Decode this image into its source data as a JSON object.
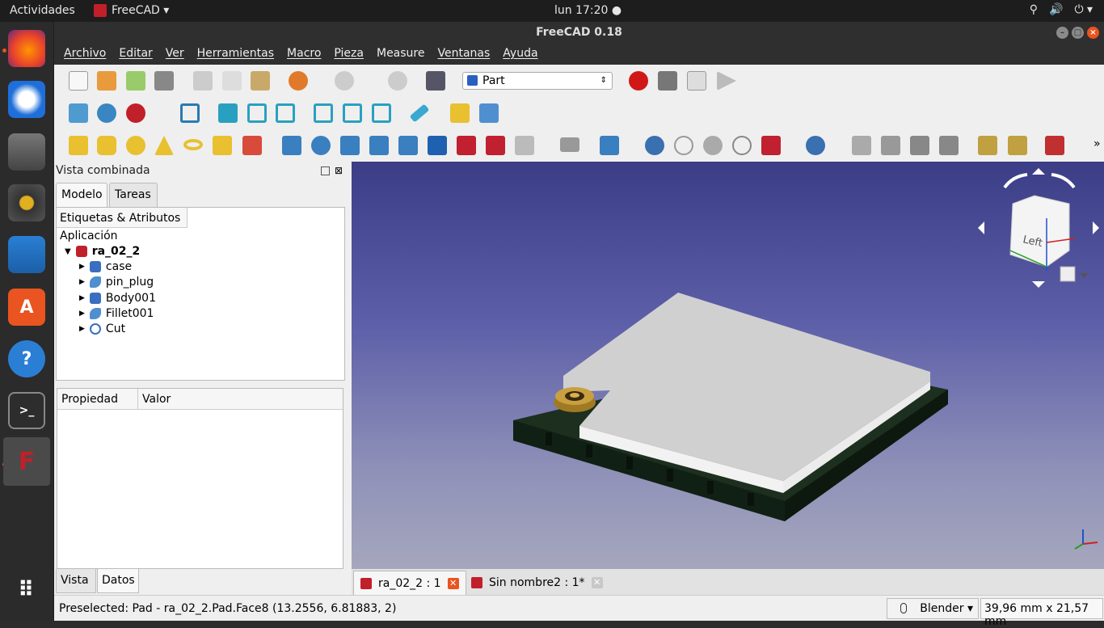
{
  "topbar": {
    "activities": "Actividades",
    "app_name": "FreeCAD ▾",
    "clock": "lun 17:20 ●",
    "sys_icons": [
      "network-icon",
      "volume-icon",
      "power-icon"
    ]
  },
  "window": {
    "title": "FreeCAD 0.18"
  },
  "menu": [
    "Archivo",
    "Editar",
    "Ver",
    "Herramientas",
    "Macro",
    "Pieza",
    "Measure",
    "Ventanas",
    "Ayuda"
  ],
  "workbench": "Part",
  "panel": {
    "title": "Vista combinada",
    "tabs": [
      "Modelo",
      "Tareas"
    ],
    "tree_header": "Etiquetas & Atributos",
    "tree_root": "Aplicación",
    "document": "ra_02_2",
    "objects": [
      "case",
      "pin_plug",
      "Body001",
      "Fillet001",
      "Cut"
    ],
    "prop_headers": [
      "Propiedad",
      "Valor"
    ],
    "bottom_tabs": [
      "Vista",
      "Datos"
    ]
  },
  "viewcube": {
    "face_label": "Left"
  },
  "doc_tabs": [
    "ra_02_2 : 1",
    "Sin nombre2 : 1*"
  ],
  "status": {
    "text": "Preselected: Pad - ra_02_2.Pad.Face8 (13.2556, 6.81883, 2)",
    "nav_style": "Blender ▾",
    "dimensions": "39,96 mm x 21,57 mm"
  },
  "colors": {
    "accent": "#e95420",
    "board": "#1a2d1c",
    "plate": "#d8d8d8",
    "connector": "#b8912c"
  }
}
